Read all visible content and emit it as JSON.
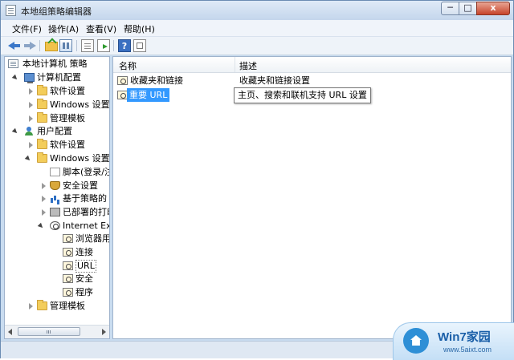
{
  "window": {
    "title": "本地组策略编辑器",
    "min_glyph": "─",
    "max_glyph": "□",
    "close_glyph": "x"
  },
  "menu": [
    "文件(F)",
    "操作(A)",
    "查看(V)",
    "帮助(H)"
  ],
  "toolbar": {
    "help_glyph": "?"
  },
  "tree": [
    {
      "label": "本地计算机 策略",
      "icon": "doc-icon"
    },
    {
      "label": "计算机配置",
      "icon": "computer-icon"
    },
    {
      "label": "软件设置",
      "icon": "folder-icon"
    },
    {
      "label": "Windows 设置",
      "icon": "folder-icon"
    },
    {
      "label": "管理模板",
      "icon": "folder-icon"
    },
    {
      "label": "用户配置",
      "icon": "user-icon"
    },
    {
      "label": "软件设置",
      "icon": "folder-icon"
    },
    {
      "label": "Windows 设置",
      "icon": "folder-icon"
    },
    {
      "label": "脚本(登录/注",
      "icon": "script-icon"
    },
    {
      "label": "安全设置",
      "icon": "shield-icon"
    },
    {
      "label": "基于策略的 Q",
      "icon": "chart-icon"
    },
    {
      "label": "已部署的打印",
      "icon": "printer-icon"
    },
    {
      "label": "Internet Exp",
      "icon": "ie-icon"
    },
    {
      "label": "浏览器用户",
      "icon": "cog-icon"
    },
    {
      "label": "连接",
      "icon": "cog-icon"
    },
    {
      "label": "URL",
      "icon": "cog-icon"
    },
    {
      "label": "安全",
      "icon": "cog-icon"
    },
    {
      "label": "程序",
      "icon": "cog-icon"
    },
    {
      "label": "管理模板",
      "icon": "folder-icon"
    }
  ],
  "list": {
    "columns": [
      "名称",
      "描述"
    ],
    "rows": [
      {
        "name": "收藏夹和链接",
        "desc": "收藏夹和链接设置"
      },
      {
        "name": "重要 URL",
        "desc": ""
      }
    ],
    "tooltip": "主页、搜索和联机支持 URL 设置"
  },
  "watermark": {
    "brand": "Win7家园",
    "url": "www.5aixt.com"
  },
  "colors": {
    "selection": "#3399ff",
    "window_frame": "#c9dcf0",
    "close_button": "#c7442a"
  }
}
